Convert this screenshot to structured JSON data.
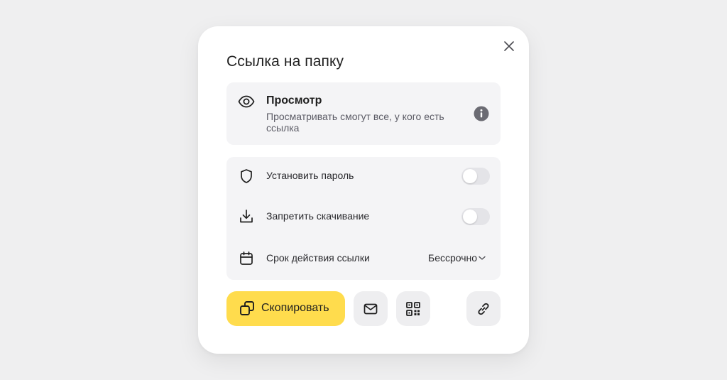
{
  "dialog": {
    "title": "Ссылка на папку",
    "close_icon": "close-icon"
  },
  "access": {
    "icon": "eye-icon",
    "title": "Просмотр",
    "description": "Просматривать смогут все, у кого есть ссылка",
    "info_icon": "info-icon"
  },
  "settings": {
    "password": {
      "icon": "shield-icon",
      "label": "Установить пароль",
      "enabled": false
    },
    "download": {
      "icon": "download-icon",
      "label": "Запретить скачивание",
      "enabled": false
    },
    "expiry": {
      "icon": "calendar-icon",
      "label": "Срок действия ссылки",
      "value": "Бессрочно"
    }
  },
  "actions": {
    "copy_label": "Скопировать",
    "copy_icon": "copy-icon",
    "mail_icon": "mail-icon",
    "qr_icon": "qr-code-icon",
    "link_icon": "link-icon"
  },
  "colors": {
    "background": "#efeff0",
    "dialog": "#ffffff",
    "card": "#f4f4f6",
    "accent": "#ffdc4d",
    "icon_button": "#eeeef0"
  }
}
